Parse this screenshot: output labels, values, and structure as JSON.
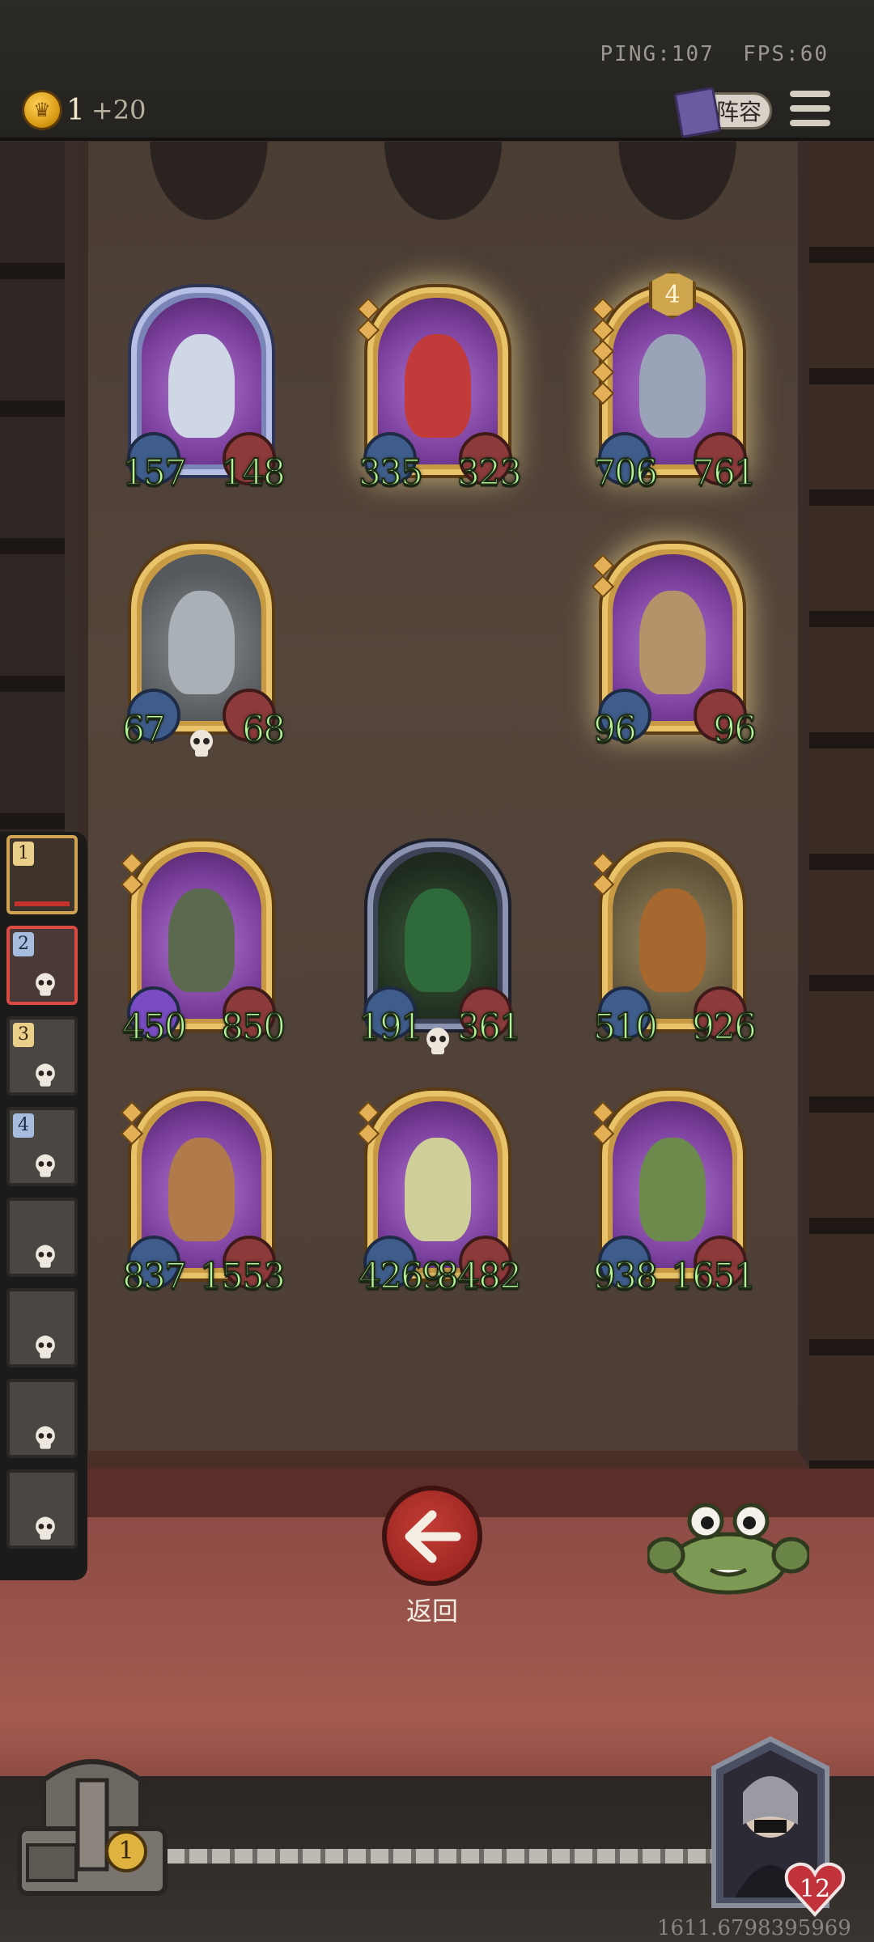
{
  "network": {
    "ping": "PING:107",
    "fps": "FPS:60"
  },
  "coins": {
    "value": "1",
    "income": "+20"
  },
  "lineup_button": {
    "label": "阵容"
  },
  "cards": [
    {
      "attack": "157",
      "health": "148"
    },
    {
      "attack": "335",
      "health": "323"
    },
    {
      "attack": "706",
      "health": "761",
      "level": "4"
    },
    {
      "attack": "67",
      "health": "68"
    },
    {
      "attack": "96",
      "health": "96"
    },
    {
      "attack": "450",
      "health": "850"
    },
    {
      "attack": "191",
      "health": "361"
    },
    {
      "attack": "510",
      "health": "926"
    },
    {
      "attack": "837",
      "health": "1553"
    },
    {
      "attack": "4269",
      "health": "8482"
    },
    {
      "attack": "938",
      "health": "1651"
    }
  ],
  "sidebar": {
    "slots": [
      "1",
      "2",
      "3",
      "4"
    ]
  },
  "back_button": {
    "label": "返回"
  },
  "chest": {
    "count": "1"
  },
  "hero": {
    "health": "12"
  },
  "coordinate_readout": "1611.6798395969",
  "colors": {
    "stat_text": "#b6f59a",
    "gold_frame": "#e8c36a",
    "back_button": "#c43c35"
  }
}
